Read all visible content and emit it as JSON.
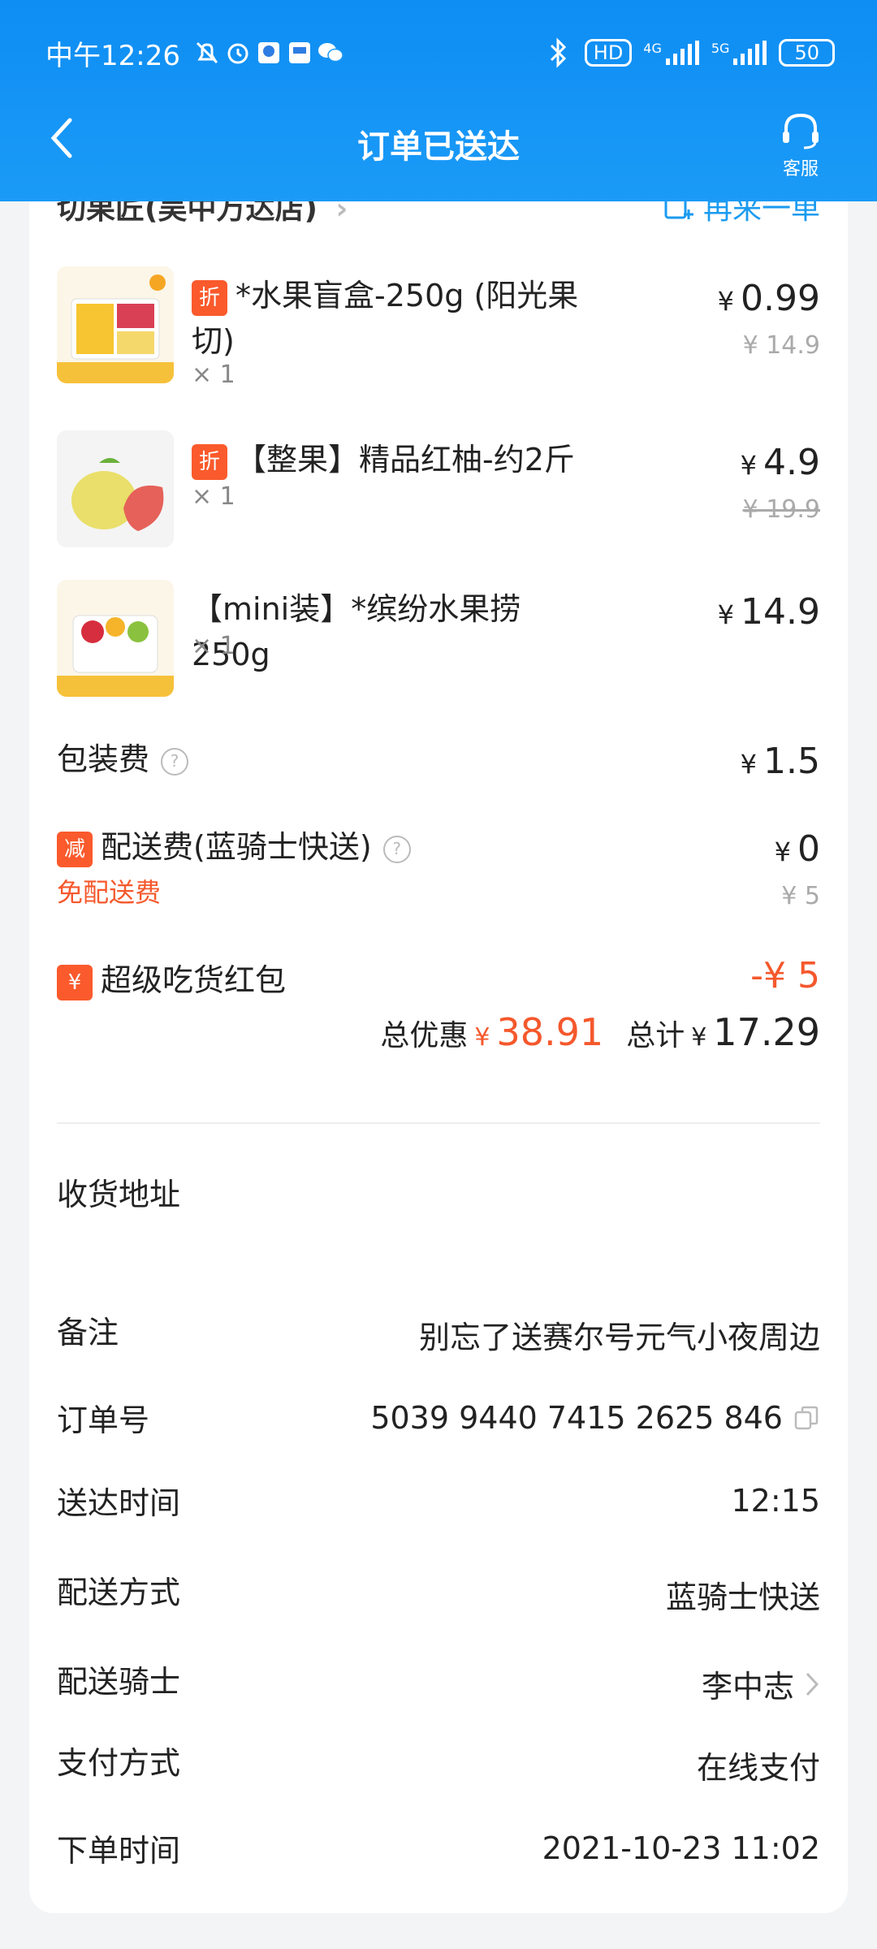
{
  "status_bar": {
    "time": "中午12:26",
    "network_4g": "4G",
    "network_5g": "5G",
    "hd": "HD",
    "battery": "50"
  },
  "nav": {
    "title": "订单已送达",
    "service_label": "客服"
  },
  "store": {
    "name": "切果匠(吴中万达店)",
    "reorder_label": "再来一单"
  },
  "items": [
    {
      "tag": "折",
      "title": "*水果盲盒-250g (阳光果切)",
      "qty": "× 1",
      "price": "0.99",
      "original_price": "¥ 14.9"
    },
    {
      "tag": "折",
      "title": "【整果】精品红柚-约2斤",
      "qty": "× 1",
      "price": "4.9",
      "original_price": "¥ 19.9"
    },
    {
      "tag": "",
      "title": "【mini装】*缤纷水果捞 250g",
      "qty": "× 1",
      "price": "14.9",
      "original_price": ""
    }
  ],
  "fees": {
    "packing_label": "包装费",
    "packing_value": "1.5",
    "delivery_tag": "减",
    "delivery_label": "配送费(蓝骑士快送)",
    "delivery_value": "0",
    "delivery_original": "¥ 5",
    "free_delivery": "免配送费",
    "redpacket_tag": "¥",
    "redpacket_label": "超级吃货红包",
    "redpacket_value": "-¥ 5"
  },
  "totals": {
    "discount_label": "总优惠",
    "discount_value": "38.91",
    "total_label": "总计",
    "total_value": "17.29",
    "currency": "¥"
  },
  "info": {
    "address_label": "收货地址",
    "remark_label": "备注",
    "remark_value": "别忘了送赛尔号元气小夜周边",
    "order_no_label": "订单号",
    "order_no_value": "5039 9440 7415 2625 846",
    "delivered_label": "送达时间",
    "delivered_value": "12:15",
    "method_label": "配送方式",
    "method_value": "蓝骑士快送",
    "rider_label": "配送骑士",
    "rider_value": "李中志",
    "payment_label": "支付方式",
    "payment_value": "在线支付",
    "order_time_label": "下单时间",
    "order_time_value": "2021-10-23 11:02"
  },
  "colors": {
    "header": "#0e8df3",
    "accent": "#1a9bf0",
    "discount": "#f5582c"
  }
}
